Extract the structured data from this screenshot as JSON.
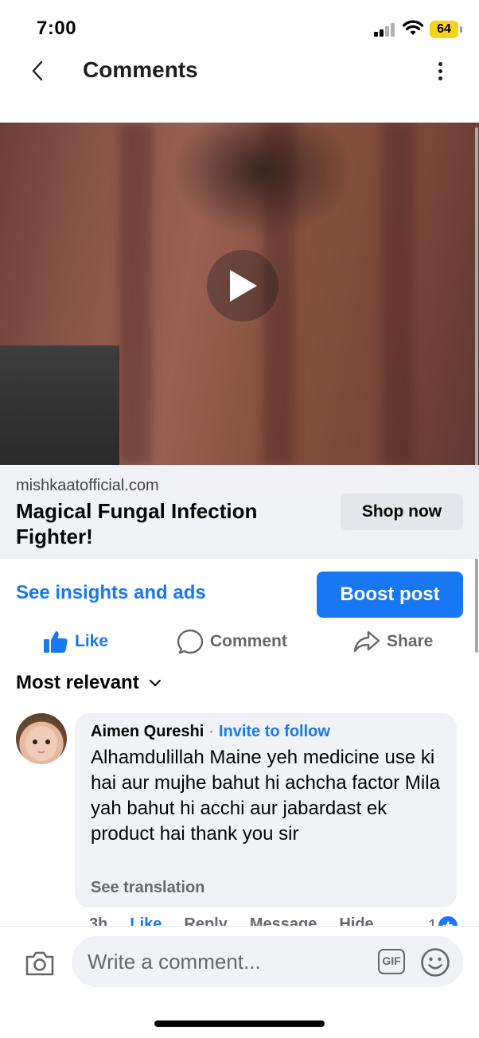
{
  "status": {
    "time": "7:00",
    "battery": "64"
  },
  "header": {
    "title": "Comments"
  },
  "post": {
    "link_domain": "mishkaatofficial.com",
    "link_title": "Magical Fungal Infection Fighter!",
    "cta_label": "Shop now",
    "insights_label": "See insights and ads",
    "boost_label": "Boost post"
  },
  "actions": {
    "like": "Like",
    "comment": "Comment",
    "share": "Share"
  },
  "sort": {
    "label": "Most relevant"
  },
  "comments": [
    {
      "author": "Aimen Qureshi",
      "separator": "·",
      "follow_label": "Invite to follow",
      "text": "Alhamdulillah Maine yeh medicine use ki hai aur mujhe bahut hi achcha factor Mila yah bahut hi acchi aur jabardast ek product hai thank you sir",
      "translation_label": "See translation",
      "time": "3h",
      "like_label": "Like",
      "reply_label": "Reply",
      "message_label": "Message",
      "hide_label": "Hide",
      "reaction_count": "1"
    }
  ],
  "composer": {
    "placeholder": "Write a comment...",
    "gif_label": "GIF"
  },
  "colors": {
    "accent": "#1877f2",
    "muted": "#65676b",
    "surface": "#f0f2f5"
  }
}
